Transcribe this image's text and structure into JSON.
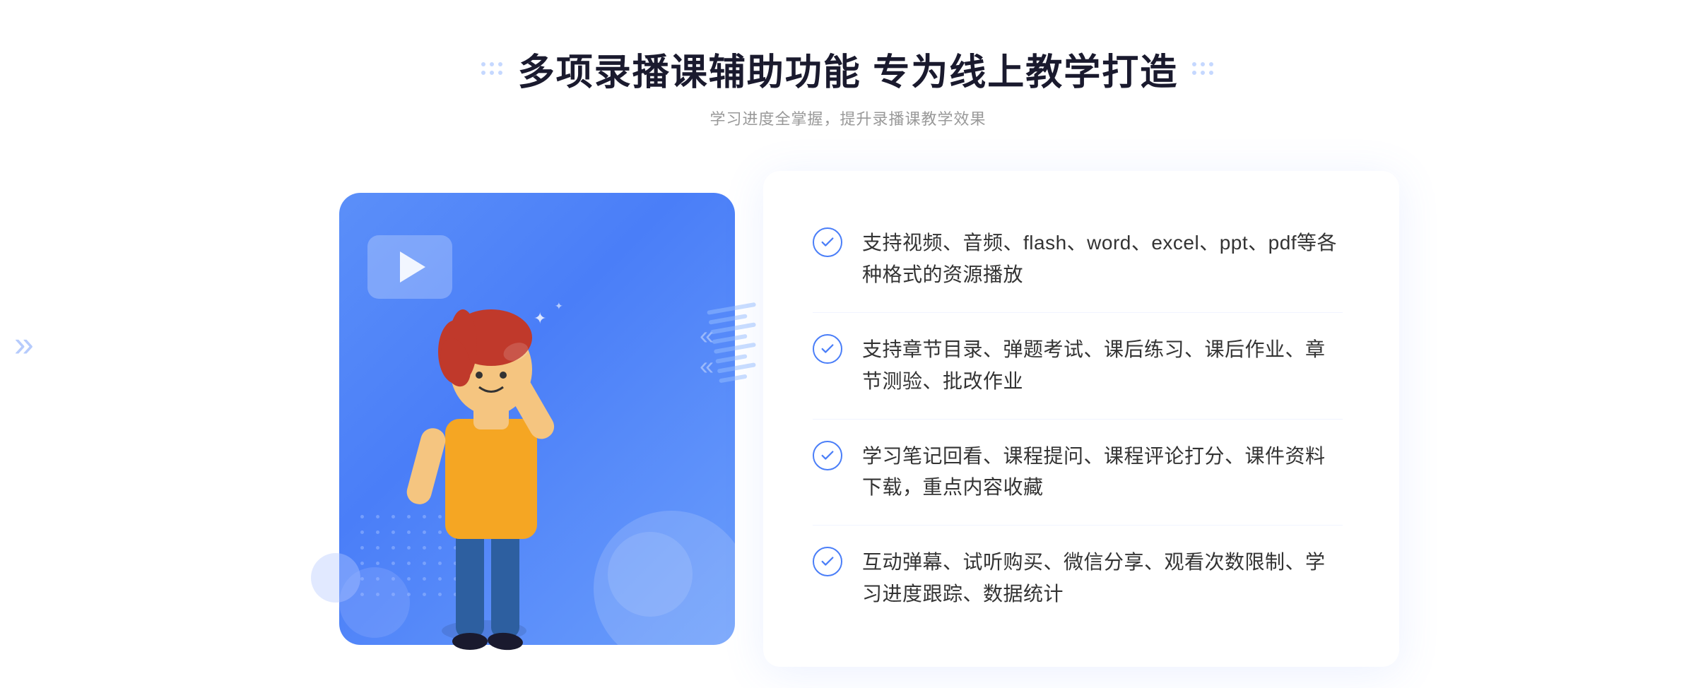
{
  "header": {
    "title": "多项录播课辅助功能 专为线上教学打造",
    "subtitle": "学习进度全掌握，提升录播课教学效果"
  },
  "features": [
    {
      "id": 1,
      "text": "支持视频、音频、flash、word、excel、ppt、pdf等各种格式的资源播放"
    },
    {
      "id": 2,
      "text": "支持章节目录、弹题考试、课后练习、课后作业、章节测验、批改作业"
    },
    {
      "id": 3,
      "text": "学习笔记回看、课程提问、课程评论打分、课件资料下载，重点内容收藏"
    },
    {
      "id": 4,
      "text": "互动弹幕、试听购买、微信分享、观看次数限制、学习进度跟踪、数据统计"
    }
  ],
  "decoration": {
    "left_arrows": "»",
    "checkmark": "✓"
  }
}
